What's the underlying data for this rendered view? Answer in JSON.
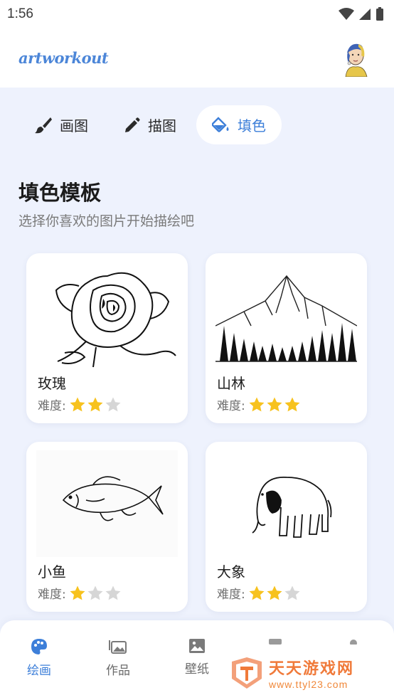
{
  "status_bar": {
    "time": "1:56"
  },
  "header": {
    "logo": "artworkout"
  },
  "tabs": [
    {
      "label": "画图",
      "icon": "paint-brush-icon",
      "active": false
    },
    {
      "label": "描图",
      "icon": "pencil-icon",
      "active": false
    },
    {
      "label": "填色",
      "icon": "paint-bucket-icon",
      "active": true
    }
  ],
  "section": {
    "title": "填色模板",
    "subtitle": "选择你喜欢的图片开始描绘吧"
  },
  "difficulty_label": "难度:",
  "cards": [
    {
      "name": "玫瑰",
      "difficulty": 2,
      "image": "rose-drawing"
    },
    {
      "name": "山林",
      "difficulty": 3,
      "image": "mountain-forest-drawing"
    },
    {
      "name": "小鱼",
      "difficulty": 1,
      "image": "fish-drawing"
    },
    {
      "name": "大象",
      "difficulty": 2,
      "image": "elephant-drawing"
    }
  ],
  "bottom_nav": [
    {
      "label": "绘画",
      "icon": "palette-icon",
      "active": true
    },
    {
      "label": "作品",
      "icon": "gallery-icon",
      "active": false
    },
    {
      "label": "壁纸",
      "icon": "image-icon",
      "active": false
    }
  ],
  "watermark": {
    "title": "天天游戏网",
    "url": "www.ttyl23.com"
  },
  "colors": {
    "accent": "#3d7fd9",
    "star_on": "#f7c21e",
    "star_off": "#d6d6d6",
    "background": "#eef2fd"
  }
}
